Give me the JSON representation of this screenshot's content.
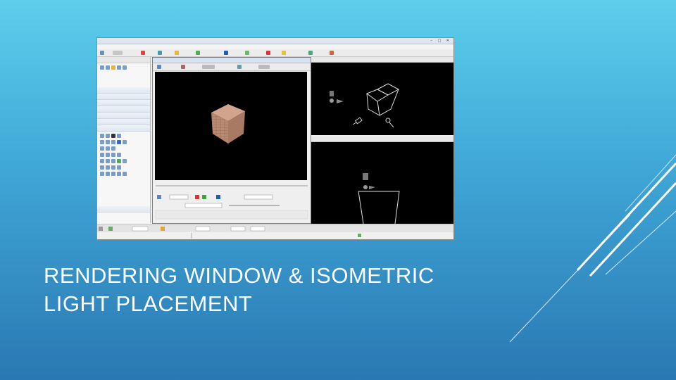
{
  "slide": {
    "title_line1": "RENDERING WINDOW & ISOMETRIC",
    "title_line2": "LIGHT PLACEMENT",
    "background_top": "#5ccfec",
    "background_bottom": "#2a78b3",
    "accent_line_color": "#ffffff"
  },
  "screenshot": {
    "description_icon": "3d-modeling-application",
    "viewport_color": "#000000",
    "cube_color": "#b88a72"
  }
}
